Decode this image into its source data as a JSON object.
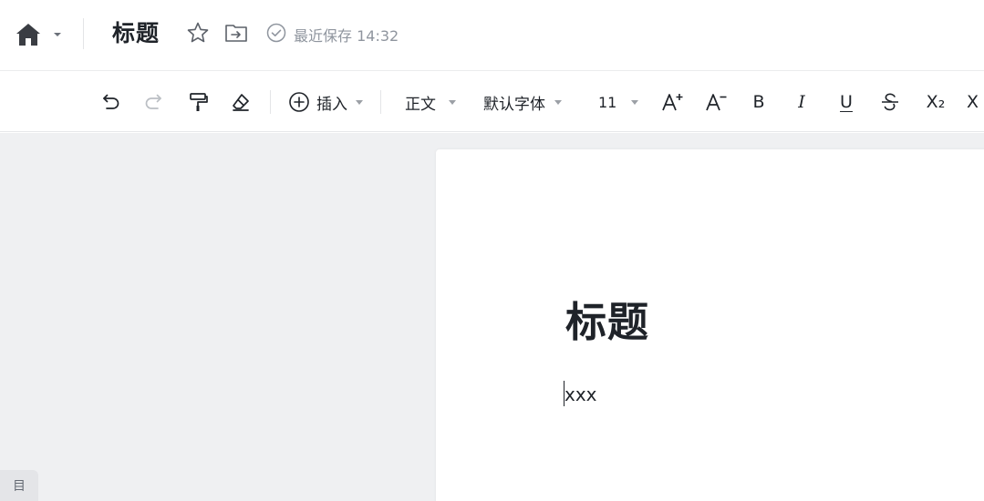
{
  "header": {
    "title": "标题",
    "save_status": "最近保存 14:32"
  },
  "toolbar": {
    "insert_label": "插入",
    "style_label": "正文",
    "font_label": "默认字体",
    "size_label": "11",
    "bold_label": "B",
    "italic_label": "I",
    "underline_label": "U",
    "subscript_label": "X₂",
    "superscript_label": "X"
  },
  "document": {
    "heading": "标题",
    "body": "xxx"
  },
  "sidebar": {
    "outline_label": "目"
  },
  "icons": [
    "home-icon",
    "chevron-down-icon",
    "star-icon",
    "move-to-folder-icon",
    "saved-check-icon",
    "undo-icon",
    "redo-icon",
    "format-painter-icon",
    "eraser-icon",
    "plus-circle-icon",
    "font-size-increase-icon",
    "font-size-decrease-icon",
    "strikethrough-icon"
  ],
  "colors": {
    "text": "#1f2329",
    "muted": "#8f959e",
    "disabled": "#bbbfc4",
    "workspace_bg": "#eff0f2"
  }
}
